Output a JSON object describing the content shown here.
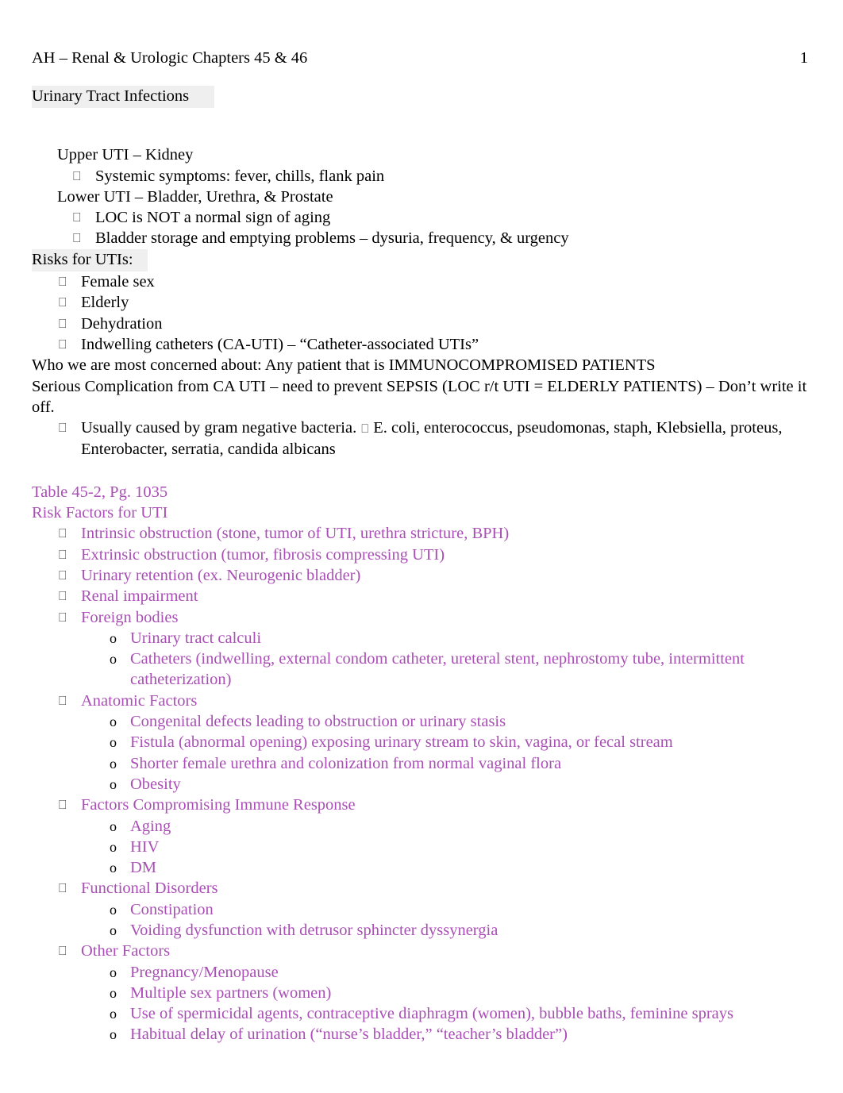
{
  "header": {
    "title": "AH – Renal & Urologic Chapters 45 & 46",
    "page_number": "1"
  },
  "colors": {
    "body_text": "#000000",
    "accent_purple": "#a94fb5",
    "highlight_gray": "#efefef"
  },
  "glyphs": {
    "box_bullet": "⎕",
    "o_bullet": "o"
  },
  "section_black": {
    "title": "Urinary Tract Infections",
    "upper_uti_heading": "Upper UTI – Kidney",
    "upper_uti_bullet": "Systemic symptoms: fever, chills, flank pain",
    "lower_uti_heading": "Lower UTI – Bladder, Urethra, & Prostate",
    "lower_uti_bullets": [
      "LOC is NOT a normal sign of aging",
      "Bladder storage and emptying problems – dysuria, frequency, & urgency"
    ],
    "risks_heading": "Risks for UTIs:",
    "risks_items": [
      "Female sex",
      "Elderly",
      "Dehydration",
      "Indwelling catheters (CA-UTI) – “Catheter-associated UTIs”"
    ],
    "concern_line": "Who we are most concerned about: Any patient that is IMMUNOCOMPROMISED PATIENTS",
    "sepsis_line": "Serious Complication from CA UTI – need to prevent SEPSIS (LOC r/t UTI = ELDERLY PATIENTS) – Don’t write it off.",
    "bacteria_bullet_part1": "Usually caused by gram negative bacteria.",
    "bacteria_bullet_part2": "E. coli, enterococcus, pseudomonas, staph, Klebsiella, proteus, Enterobacter, serratia, candida albicans"
  },
  "section_purple": {
    "table_ref": "Table 45-2, Pg. 1035",
    "subtitle": "Risk Factors for UTI",
    "items": [
      {
        "text": "Intrinsic obstruction (stone, tumor of UTI, urethra stricture, BPH)",
        "children": []
      },
      {
        "text": "Extrinsic obstruction (tumor, fibrosis compressing UTI)",
        "children": []
      },
      {
        "text": "Urinary retention (ex. Neurogenic bladder)",
        "children": []
      },
      {
        "text": "Renal impairment",
        "children": []
      },
      {
        "text": "Foreign bodies",
        "children": [
          "Urinary tract calculi",
          "Catheters (indwelling, external condom catheter, ureteral stent, nephrostomy tube, intermittent catheterization)"
        ]
      },
      {
        "text": "Anatomic Factors",
        "children": [
          "Congenital defects leading to obstruction or urinary stasis",
          "Fistula (abnormal opening) exposing urinary stream to skin, vagina, or fecal stream",
          "Shorter female urethra and colonization from normal vaginal flora",
          "Obesity"
        ]
      },
      {
        "text": "Factors Compromising Immune Response",
        "children": [
          "Aging",
          "HIV",
          "DM"
        ]
      },
      {
        "text": "Functional Disorders",
        "children": [
          "Constipation",
          "Voiding dysfunction with detrusor sphincter dyssynergia"
        ]
      },
      {
        "text": "Other Factors",
        "children": [
          "Pregnancy/Menopause",
          "Multiple sex partners (women)",
          "Use of spermicidal agents, contraceptive diaphragm (women), bubble baths, feminine sprays",
          "Habitual delay of urination (“nurse’s bladder,” “teacher’s bladder”)"
        ]
      }
    ]
  }
}
